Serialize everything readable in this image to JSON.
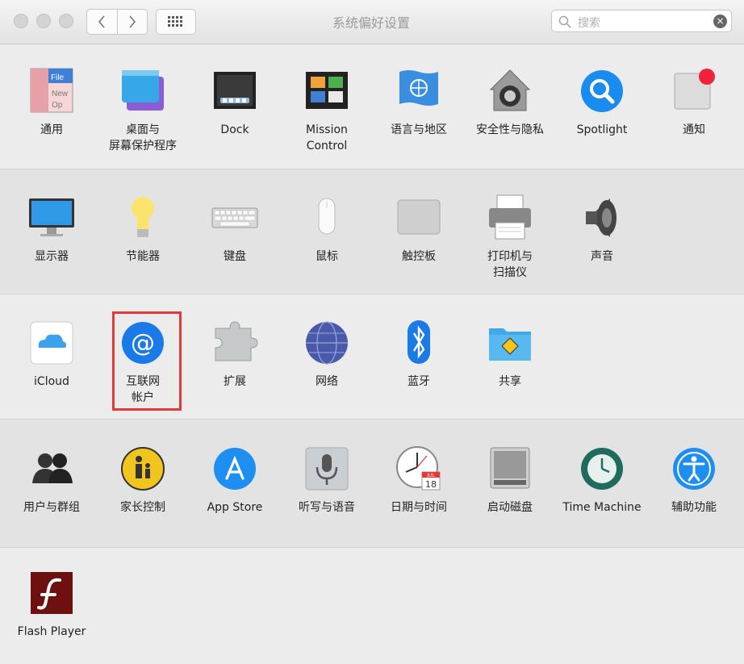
{
  "window": {
    "title": "系统偏好设置",
    "search_placeholder": "搜索"
  },
  "rows": [
    [
      {
        "id": "general",
        "label": "通用",
        "icon": "general-icon"
      },
      {
        "id": "desktop",
        "label": "桌面与\n屏幕保护程序",
        "icon": "desktop-screensaver-icon"
      },
      {
        "id": "dock",
        "label": "Dock",
        "icon": "dock-icon"
      },
      {
        "id": "mission",
        "label": "Mission\nControl",
        "icon": "mission-control-icon"
      },
      {
        "id": "language",
        "label": "语言与地区",
        "icon": "globe-flag-icon"
      },
      {
        "id": "security",
        "label": "安全性与隐私",
        "icon": "house-lock-icon"
      },
      {
        "id": "spotlight",
        "label": "Spotlight",
        "icon": "spotlight-icon"
      },
      {
        "id": "notify",
        "label": "通知",
        "icon": "notifications-icon"
      }
    ],
    [
      {
        "id": "display",
        "label": "显示器",
        "icon": "display-icon"
      },
      {
        "id": "energy",
        "label": "节能器",
        "icon": "lightbulb-icon"
      },
      {
        "id": "keyboard",
        "label": "键盘",
        "icon": "keyboard-icon"
      },
      {
        "id": "mouse",
        "label": "鼠标",
        "icon": "mouse-icon"
      },
      {
        "id": "trackpad",
        "label": "触控板",
        "icon": "trackpad-icon"
      },
      {
        "id": "printer",
        "label": "打印机与\n扫描仪",
        "icon": "printer-icon"
      },
      {
        "id": "sound",
        "label": "声音",
        "icon": "speaker-icon"
      }
    ],
    [
      {
        "id": "icloud",
        "label": "iCloud",
        "icon": "icloud-icon"
      },
      {
        "id": "internet",
        "label": "互联网\n帐户",
        "icon": "at-sign-icon"
      },
      {
        "id": "extensions",
        "label": "扩展",
        "icon": "puzzle-icon"
      },
      {
        "id": "network",
        "label": "网络",
        "icon": "network-globe-icon"
      },
      {
        "id": "bluetooth",
        "label": "蓝牙",
        "icon": "bluetooth-icon"
      },
      {
        "id": "sharing",
        "label": "共享",
        "icon": "sharing-folder-icon"
      }
    ],
    [
      {
        "id": "users",
        "label": "用户与群组",
        "icon": "users-icon"
      },
      {
        "id": "parental",
        "label": "家长控制",
        "icon": "parental-icon"
      },
      {
        "id": "appstore",
        "label": "App Store",
        "icon": "app-store-icon"
      },
      {
        "id": "dictation",
        "label": "听写与语音",
        "icon": "microphone-icon"
      },
      {
        "id": "datetime",
        "label": "日期与时间",
        "icon": "clock-calendar-icon"
      },
      {
        "id": "startup",
        "label": "启动磁盘",
        "icon": "hard-disk-icon"
      },
      {
        "id": "timemachine",
        "label": "Time Machine",
        "icon": "time-machine-icon"
      },
      {
        "id": "access",
        "label": "辅助功能",
        "icon": "accessibility-icon"
      }
    ],
    [
      {
        "id": "flash",
        "label": "Flash Player",
        "icon": "flash-icon"
      }
    ]
  ],
  "calendar": {
    "month": "JUL",
    "day": "18"
  },
  "highlighted": "internet",
  "colors": {
    "highlight": "#e03a3a",
    "accent": "#1a7ae8"
  }
}
